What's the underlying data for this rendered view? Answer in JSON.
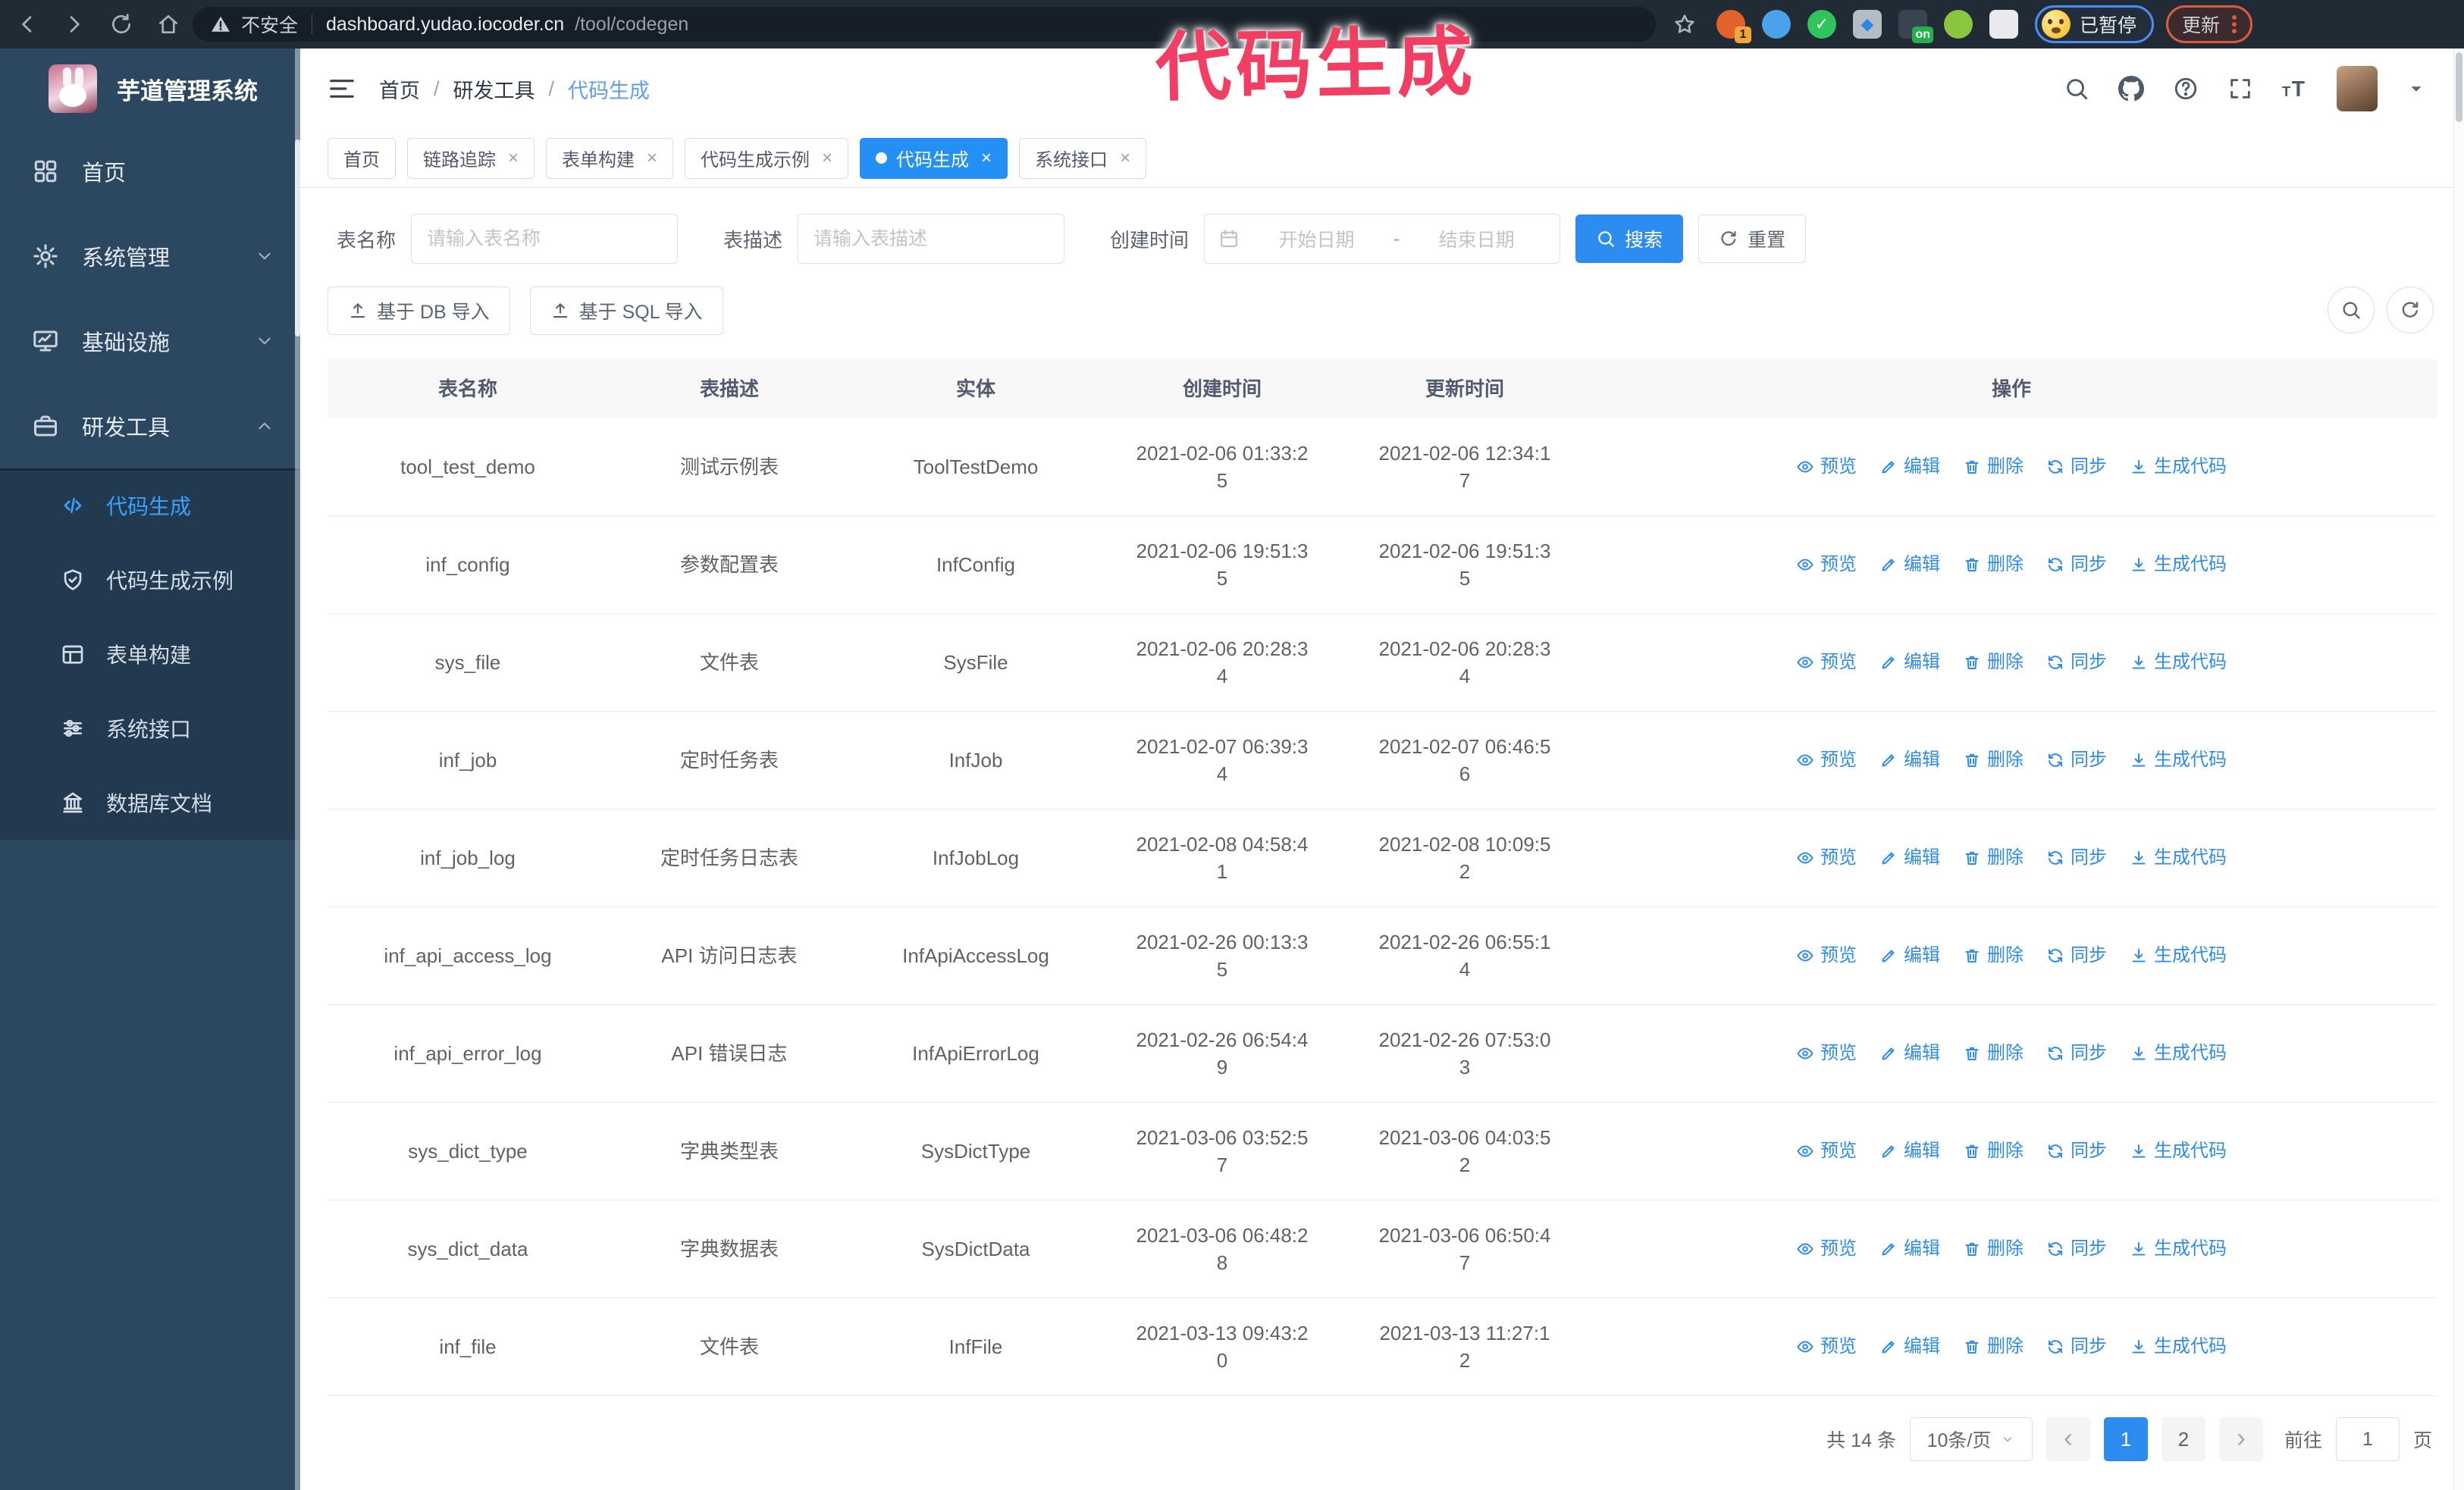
{
  "colors": {
    "primary": "#2d8cf0",
    "sidebar_bg": "#2c4861",
    "submenu_bg": "#223a50",
    "active_tab": "#2490f5",
    "annotation": "#f23e63",
    "browser_bar": "#202b36"
  },
  "browser": {
    "security_label": "不安全",
    "url_host": "dashboard.yudao.iocoder.cn",
    "url_path": "/tool/codegen",
    "paused_badge": "已暂停",
    "update_label": "更新",
    "extensions": [
      {
        "name": "extension-orange-icon",
        "shape": "circle",
        "color": "#e2622b",
        "badge": "1",
        "badge_color": "#f3a43b"
      },
      {
        "name": "extension-gem-icon",
        "shape": "circle",
        "color": "#4aa3e8"
      },
      {
        "name": "extension-check-icon",
        "shape": "circle",
        "color": "#2fc45c",
        "glyph": "✓"
      },
      {
        "name": "extension-panel-icon",
        "shape": "square",
        "color": "#b4bcc4",
        "glyph": "◆",
        "glyph_color": "#2f86e8"
      },
      {
        "name": "extension-switch-icon",
        "shape": "square",
        "color": "#3a4450",
        "badge": "on",
        "badge_color": "#23b14d"
      },
      {
        "name": "extension-key-icon",
        "shape": "circle",
        "color": "#8cc63e"
      },
      {
        "name": "extension-puzzle-icon",
        "shape": "square",
        "color": "#e8eaed"
      }
    ]
  },
  "annotation": {
    "text": "代码生成"
  },
  "sidebar": {
    "logo_title": "芋道管理系统",
    "menu": [
      {
        "label": "首页",
        "icon": "dashboard-icon"
      },
      {
        "label": "系统管理",
        "icon": "gear-icon",
        "chevron": "down"
      },
      {
        "label": "基础设施",
        "icon": "monitor-icon",
        "chevron": "down"
      },
      {
        "label": "研发工具",
        "icon": "toolbox-icon",
        "chevron": "up",
        "expanded": true,
        "children": [
          {
            "label": "代码生成",
            "icon": "code-icon",
            "active": true
          },
          {
            "label": "代码生成示例",
            "icon": "shield-check-icon"
          },
          {
            "label": "表单构建",
            "icon": "form-icon"
          },
          {
            "label": "系统接口",
            "icon": "sliders-icon"
          },
          {
            "label": "数据库文档",
            "icon": "database-icon"
          }
        ]
      }
    ]
  },
  "topbar": {
    "breadcrumb": [
      "首页",
      "研发工具",
      "代码生成"
    ],
    "icons": [
      "search-icon",
      "github-icon",
      "help-icon",
      "fullscreen-icon",
      "font-size-icon"
    ]
  },
  "tabs": [
    {
      "label": "首页",
      "closable": false
    },
    {
      "label": "链路追踪",
      "closable": true
    },
    {
      "label": "表单构建",
      "closable": true
    },
    {
      "label": "代码生成示例",
      "closable": true
    },
    {
      "label": "代码生成",
      "closable": true,
      "active": true
    },
    {
      "label": "系统接口",
      "closable": true
    }
  ],
  "search_form": {
    "name_label": "表名称",
    "name_placeholder": "请输入表名称",
    "desc_label": "表描述",
    "desc_placeholder": "请输入表描述",
    "time_label": "创建时间",
    "start_placeholder": "开始日期",
    "end_placeholder": "结束日期",
    "range_separator": "-",
    "search_label": "搜索",
    "reset_label": "重置"
  },
  "toolbar": {
    "import_db_label": "基于 DB 导入",
    "import_sql_label": "基于 SQL 导入"
  },
  "table": {
    "columns": [
      "表名称",
      "表描述",
      "实体",
      "创建时间",
      "更新时间",
      "操作"
    ],
    "actions": [
      {
        "label": "预览",
        "icon": "eye-icon"
      },
      {
        "label": "编辑",
        "icon": "edit-icon"
      },
      {
        "label": "删除",
        "icon": "delete-icon"
      },
      {
        "label": "同步",
        "icon": "sync-icon"
      },
      {
        "label": "生成代码",
        "icon": "download-icon"
      }
    ],
    "rows": [
      {
        "name": "tool_test_demo",
        "desc": "测试示例表",
        "entity": "ToolTestDemo",
        "create_time": "2021-02-06 01:33:25",
        "update_time": "2021-02-06 12:34:17"
      },
      {
        "name": "inf_config",
        "desc": "参数配置表",
        "entity": "InfConfig",
        "create_time": "2021-02-06 19:51:35",
        "update_time": "2021-02-06 19:51:35"
      },
      {
        "name": "sys_file",
        "desc": "文件表",
        "entity": "SysFile",
        "create_time": "2021-02-06 20:28:34",
        "update_time": "2021-02-06 20:28:34"
      },
      {
        "name": "inf_job",
        "desc": "定时任务表",
        "entity": "InfJob",
        "create_time": "2021-02-07 06:39:34",
        "update_time": "2021-02-07 06:46:56"
      },
      {
        "name": "inf_job_log",
        "desc": "定时任务日志表",
        "entity": "InfJobLog",
        "create_time": "2021-02-08 04:58:41",
        "update_time": "2021-02-08 10:09:52"
      },
      {
        "name": "inf_api_access_log",
        "desc": "API 访问日志表",
        "entity": "InfApiAccessLog",
        "create_time": "2021-02-26 00:13:35",
        "update_time": "2021-02-26 06:55:14"
      },
      {
        "name": "inf_api_error_log",
        "desc": "API 错误日志",
        "entity": "InfApiErrorLog",
        "create_time": "2021-02-26 06:54:49",
        "update_time": "2021-02-26 07:53:03"
      },
      {
        "name": "sys_dict_type",
        "desc": "字典类型表",
        "entity": "SysDictType",
        "create_time": "2021-03-06 03:52:57",
        "update_time": "2021-03-06 04:03:52"
      },
      {
        "name": "sys_dict_data",
        "desc": "字典数据表",
        "entity": "SysDictData",
        "create_time": "2021-03-06 06:48:28",
        "update_time": "2021-03-06 06:50:47"
      },
      {
        "name": "inf_file",
        "desc": "文件表",
        "entity": "InfFile",
        "create_time": "2021-03-13 09:43:20",
        "update_time": "2021-03-13 11:27:12"
      }
    ]
  },
  "pagination": {
    "total": "共 14 条",
    "page_size": "10条/页",
    "pages": [
      "1",
      "2"
    ],
    "active_page": "1",
    "prev_icon": "‹",
    "next_icon": "›",
    "goto_label": "前往",
    "goto_value": "1",
    "page_unit": "页"
  }
}
